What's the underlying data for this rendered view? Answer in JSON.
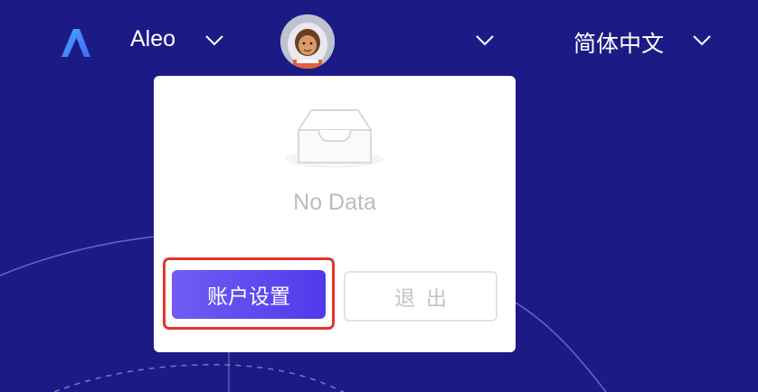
{
  "header": {
    "network_name": "Aleo",
    "language_label": "简体中文",
    "icons": {
      "logo": "aleo-logo-icon",
      "network_chevron": "chevron-down-icon",
      "account_chevron": "chevron-down-icon",
      "language_chevron": "chevron-down-icon",
      "avatar": "astronaut-avatar"
    }
  },
  "dropdown": {
    "empty_text": "No Data",
    "empty_icon": "empty-inbox-icon",
    "primary_button_label": "账户设置",
    "secondary_button_label": "退出"
  },
  "colors": {
    "background": "#1c1b86",
    "accent": "#5a44ef",
    "highlight": "#e3332a"
  }
}
